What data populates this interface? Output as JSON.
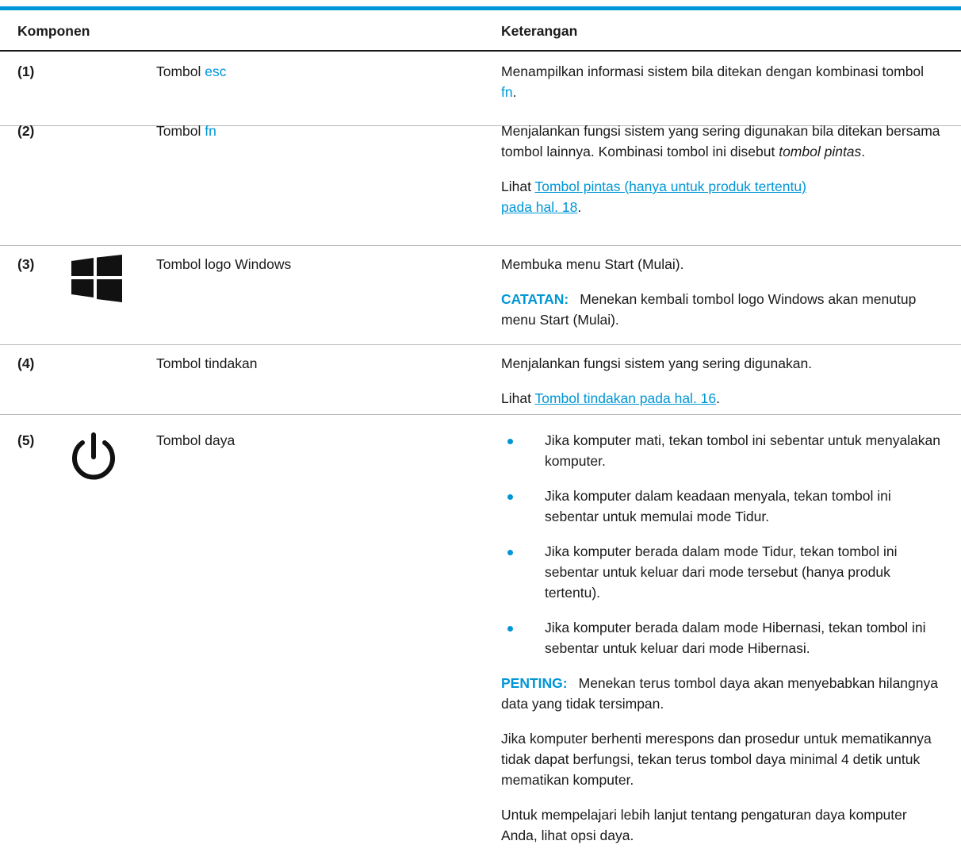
{
  "colors": {
    "accent": "#0096d6",
    "text": "#1a1a1a",
    "rule": "#b8b8b8"
  },
  "table": {
    "headers": {
      "component": "Komponen",
      "description": "Keterangan"
    },
    "rows": [
      {
        "num": "(1)",
        "comp_prefix": "Tombol ",
        "comp_key": "esc",
        "desc": {
          "p1_text": "Menampilkan informasi sistem bila ditekan dengan kombinasi tombol ",
          "p1_key": "fn",
          "p1_end": "."
        }
      },
      {
        "num": "(2)",
        "comp_prefix": "Tombol ",
        "comp_key": "fn",
        "desc": {
          "p1_text": "Menjalankan fungsi sistem yang sering digunakan bila ditekan bersama tombol lainnya. Kombinasi tombol ini disebut ",
          "p1_em": "tombol pintas",
          "p1_end": ".",
          "p2_prefix": "Lihat ",
          "p2_link_line1": "Tombol pintas (hanya untuk produk tertentu)",
          "p2_link_line2": "pada hal. 18",
          "p2_end": "."
        }
      },
      {
        "num": "(3)",
        "icon": "windows-logo-icon",
        "comp": "Tombol logo Windows",
        "desc": {
          "p1": "Membuka menu Start (Mulai).",
          "note_label": "CATATAN:",
          "note_text": "Menekan kembali tombol logo Windows akan menutup menu Start (Mulai)."
        }
      },
      {
        "num": "(4)",
        "comp": "Tombol tindakan",
        "desc": {
          "p1": "Menjalankan fungsi sistem yang sering digunakan.",
          "p2_prefix": "Lihat ",
          "p2_link": "Tombol tindakan pada hal. 16",
          "p2_end": "."
        }
      },
      {
        "num": "(5)",
        "icon": "power-icon",
        "comp": "Tombol daya",
        "desc": {
          "bullets": [
            "Jika komputer mati, tekan tombol ini sebentar untuk menyalakan komputer.",
            "Jika komputer dalam keadaan menyala, tekan tombol ini sebentar untuk memulai mode Tidur.",
            "Jika komputer berada dalam mode Tidur, tekan tombol ini sebentar untuk keluar dari mode tersebut (hanya produk tertentu).",
            "Jika komputer berada dalam mode Hibernasi, tekan tombol ini sebentar untuk keluar dari mode Hibernasi."
          ],
          "note_label": "PENTING:",
          "note_text": "Menekan terus tombol daya akan menyebabkan hilangnya data yang tidak tersimpan.",
          "p2": "Jika komputer berhenti merespons dan prosedur untuk mematikannya tidak dapat berfungsi, tekan terus tombol daya minimal 4 detik untuk mematikan komputer.",
          "p3": "Untuk mempelajari lebih lanjut tentang pengaturan daya komputer Anda, lihat opsi daya."
        }
      }
    ]
  }
}
